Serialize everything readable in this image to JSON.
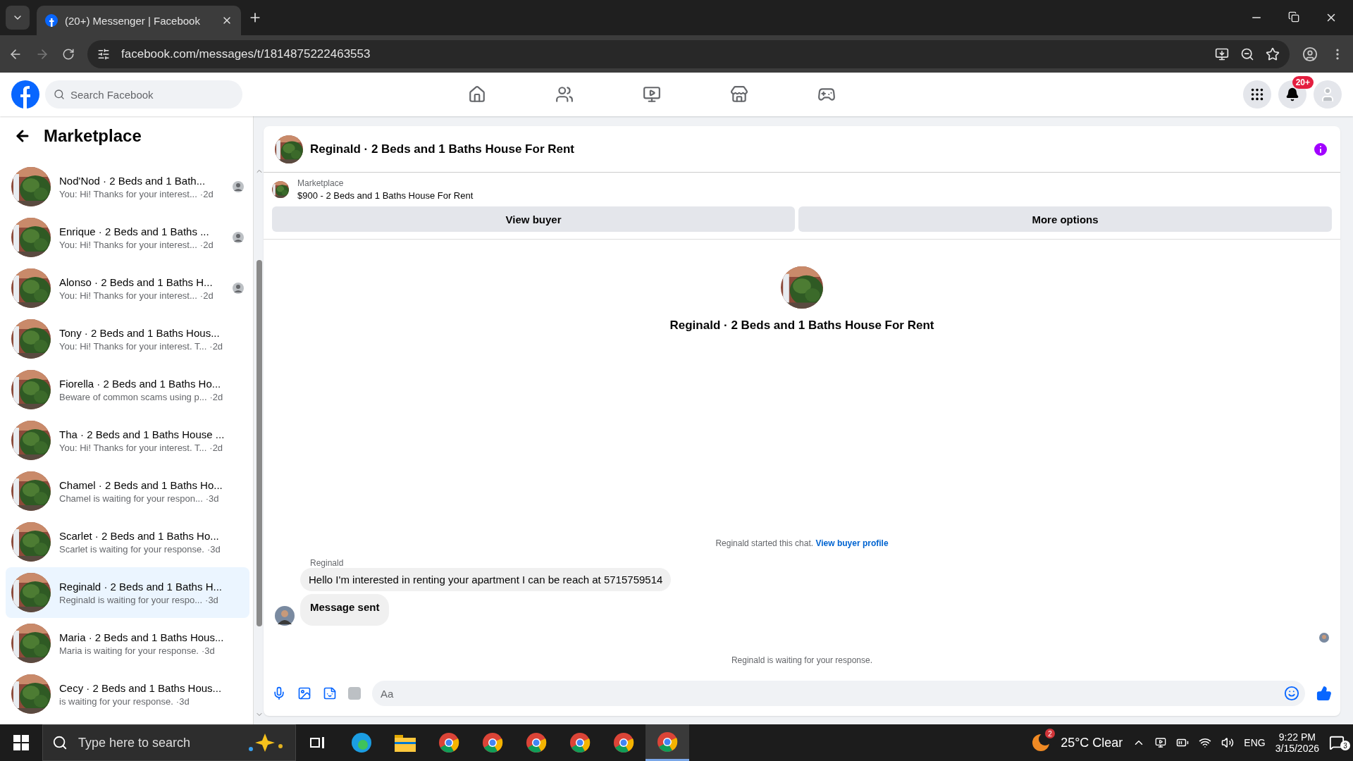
{
  "browser": {
    "tab_title": "(20+) Messenger | Facebook",
    "url": "facebook.com/messages/t/1814875222463553"
  },
  "header": {
    "search_placeholder": "Search Facebook",
    "notification_badge": "20+"
  },
  "sidebar": {
    "title": "Marketplace",
    "conversations": [
      {
        "title": "Nod'Nod · 2 Beds and 1 Bath...",
        "preview": "You: Hi! Thanks for your interest...",
        "time": "·2d",
        "selected": false,
        "seen": true
      },
      {
        "title": "Enrique · 2 Beds and 1 Baths ...",
        "preview": "You: Hi! Thanks for your interest...",
        "time": "·2d",
        "selected": false,
        "seen": true
      },
      {
        "title": "Alonso · 2 Beds and 1 Baths H...",
        "preview": "You: Hi! Thanks for your interest...",
        "time": "·2d",
        "selected": false,
        "seen": true
      },
      {
        "title": "Tony · 2 Beds and 1 Baths Hous...",
        "preview": "You: Hi! Thanks for your interest. T...",
        "time": "·2d",
        "selected": false,
        "seen": false
      },
      {
        "title": "Fiorella · 2 Beds and 1 Baths Ho...",
        "preview": "Beware of common scams using p...",
        "time": "·2d",
        "selected": false,
        "seen": false
      },
      {
        "title": "Tha · 2 Beds and 1 Baths House ...",
        "preview": "You: Hi! Thanks for your interest. T...",
        "time": "·2d",
        "selected": false,
        "seen": false
      },
      {
        "title": "Chamel · 2 Beds and 1 Baths Ho...",
        "preview": "Chamel is waiting for your respon...",
        "time": "·3d",
        "selected": false,
        "seen": false
      },
      {
        "title": "Scarlet · 2 Beds and 1 Baths Ho...",
        "preview": "Scarlet is waiting for your response.",
        "time": "·3d",
        "selected": false,
        "seen": false
      },
      {
        "title": "Reginald · 2 Beds and 1 Baths H...",
        "preview": "Reginald is waiting for your respo...",
        "time": "·3d",
        "selected": true,
        "seen": false
      },
      {
        "title": "Maria · 2 Beds and 1 Baths Hous...",
        "preview": "Maria is waiting for your response.",
        "time": "·3d",
        "selected": false,
        "seen": false
      },
      {
        "title": "Cecy · 2 Beds and 1 Baths Hous...",
        "preview": "is waiting for your response.",
        "time": "·3d",
        "selected": false,
        "seen": false
      }
    ]
  },
  "chat": {
    "title": "Reginald · 2 Beds and 1 Baths House For Rent",
    "listing": {
      "label": "Marketplace",
      "text": "$900 - 2 Beds and 1 Baths House For Rent"
    },
    "buttons": [
      "View buyer",
      "More options"
    ],
    "profile_title": "Reginald · 2 Beds and 1 Baths House For Rent",
    "notice": {
      "text": "Reginald started this chat.",
      "link": "View buyer profile"
    },
    "messages": [
      {
        "sender": "Reginald",
        "text": "Hello I'm interested in renting your apartment I can be reach at 5715759514",
        "bold": false
      },
      {
        "text": "Message sent",
        "bold": true
      }
    ],
    "status": "Reginald is waiting for your response.",
    "composer": {
      "placeholder": "Aa"
    }
  },
  "taskbar": {
    "search_placeholder": "Type here to search",
    "apps": [
      {
        "kind": "edge",
        "selected": false
      },
      {
        "kind": "explorer",
        "selected": false
      },
      {
        "kind": "chrome",
        "selected": false
      },
      {
        "kind": "chrome",
        "selected": false
      },
      {
        "kind": "chrome",
        "selected": false
      },
      {
        "kind": "chrome",
        "selected": false
      },
      {
        "kind": "chrome",
        "selected": false
      },
      {
        "kind": "chrome",
        "selected": true
      }
    ],
    "weather_badge": "2",
    "weather": "25°C Clear",
    "language": "ENG",
    "time": "9:22 PM",
    "date": "3/15/2026",
    "notification_count": "3"
  }
}
